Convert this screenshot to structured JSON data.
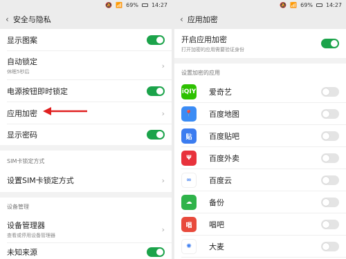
{
  "status": {
    "mute": "🔕",
    "wifi": "📶",
    "battery": "69%",
    "time": "14:27"
  },
  "left": {
    "title": "安全与隐私",
    "rows": {
      "show_pattern": "显示图案",
      "auto_lock": "自动锁定",
      "auto_lock_sub": "休眠5秒后",
      "power_lock": "电源按钮即时锁定",
      "app_lock": "应用加密",
      "show_password": "显示密码"
    },
    "sim_section": "SIM卡锁定方式",
    "sim_setting": "设置SIM卡锁定方式",
    "device_section": "设备管理",
    "device_admin": "设备管理器",
    "device_admin_sub": "查看或停用设备管理器",
    "unknown_sources": "未知来源",
    "chevron": "›",
    "back": "‹",
    "annotation_color": "#e02020"
  },
  "right": {
    "title": "应用加密",
    "enable": "开启应用加密",
    "enable_sub": "打开加密的应用需要验证身份",
    "section": "设置加密的应用",
    "apps": [
      {
        "name": "爱奇艺",
        "icon": "iqiyi-icon",
        "glyph": "iQIY",
        "color": "#2dc100"
      },
      {
        "name": "百度地图",
        "icon": "baidu-map-icon",
        "glyph": "📍",
        "color": "#3b8cf5"
      },
      {
        "name": "百度贴吧",
        "icon": "tieba-icon",
        "glyph": "贴",
        "color": "#3b7cf0"
      },
      {
        "name": "百度外卖",
        "icon": "baidu-waimai-icon",
        "glyph": "Ψ",
        "color": "#e8323c"
      },
      {
        "name": "百度云",
        "icon": "baidu-cloud-icon",
        "glyph": "∞",
        "color": "#ffffff"
      },
      {
        "name": "备份",
        "icon": "backup-icon",
        "glyph": "☁",
        "color": "#2fb34a"
      },
      {
        "name": "唱吧",
        "icon": "changba-icon",
        "glyph": "唱",
        "color": "#e84a3c"
      },
      {
        "name": "大麦",
        "icon": "damai-icon",
        "glyph": "✺",
        "color": "#ffffff"
      }
    ]
  }
}
